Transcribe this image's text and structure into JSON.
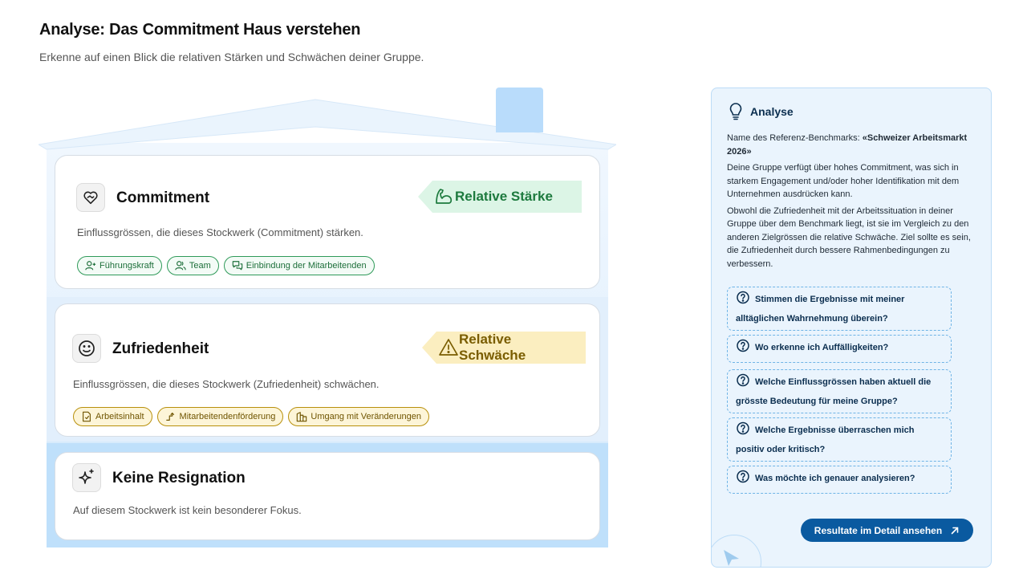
{
  "header": {
    "title": "Analyse: Das Commitment Haus verstehen",
    "subtitle": "Erkenne auf einen Blick die relativen Stärken und Schwächen deiner Gruppe."
  },
  "house": {
    "floors": [
      {
        "title": "Commitment",
        "icon": "heart-hands-icon",
        "badge": {
          "label": "Relative Stärke",
          "icon": "flexed-arm-icon",
          "color": "#dcf5e6"
        },
        "description": "Einflussgrössen, die dieses Stockwerk (Commitment) stärken.",
        "tags": [
          {
            "label": "Führungskraft",
            "icon": "person-plus-icon"
          },
          {
            "label": "Team",
            "icon": "people-icon"
          },
          {
            "label": "Einbindung der Mitarbeitenden",
            "icon": "chat-bubbles-icon"
          }
        ]
      },
      {
        "title": "Zufriedenheit",
        "icon": "smiley-icon",
        "badge": {
          "label": "Relative Schwäche",
          "icon": "warning-triangle-icon",
          "color": "#fbeec0"
        },
        "description": "Einflussgrössen, die dieses Stockwerk (Zufriedenheit) schwächen.",
        "tags": [
          {
            "label": "Arbeitsinhalt",
            "icon": "document-icon"
          },
          {
            "label": "Mitarbeitendenförderung",
            "icon": "growth-arrow-icon"
          },
          {
            "label": "Umgang mit Veränderungen",
            "icon": "buildings-icon"
          }
        ]
      },
      {
        "title": "Keine Resignation",
        "icon": "sparkles-icon",
        "description": "Auf diesem Stockwerk ist kein besonderer Fokus."
      }
    ]
  },
  "panel": {
    "title": "Analyse",
    "benchmark_prefix": "Name des Referenz-Benchmarks: ",
    "benchmark_name": "«Schweizer Arbeitsmarkt 2026»",
    "paragraph1": "Deine Gruppe verfügt über hohes Commitment, was sich in starkem Engagement und/oder hoher Identifikation mit dem Unternehmen ausdrücken kann.",
    "paragraph2": "Obwohl die Zufriedenheit mit der Arbeitssituation in deiner Gruppe über dem Benchmark liegt, ist sie im Vergleich zu den anderen Zielgrössen die relative Schwäche. Ziel sollte es sein, die Zufriedenheit durch bessere Rahmenbedingungen zu verbessern.",
    "questions": [
      "Stimmen die Ergebnisse mit meiner alltäglichen Wahrnehmung überein?",
      "Wo erkenne ich Auffälligkeiten?",
      "Welche Einflussgrössen haben aktuell die grösste Bedeutung für meine Gruppe?",
      "Welche Ergebnisse überraschen mich positiv oder kritisch?",
      "Was möchte ich genauer analysieren?"
    ],
    "cta_label": "Resultate im Detail ansehen"
  },
  "colors": {
    "accent": "#0a5aa0",
    "strength": "#1d7a3e",
    "weakness": "#7a5d00"
  }
}
